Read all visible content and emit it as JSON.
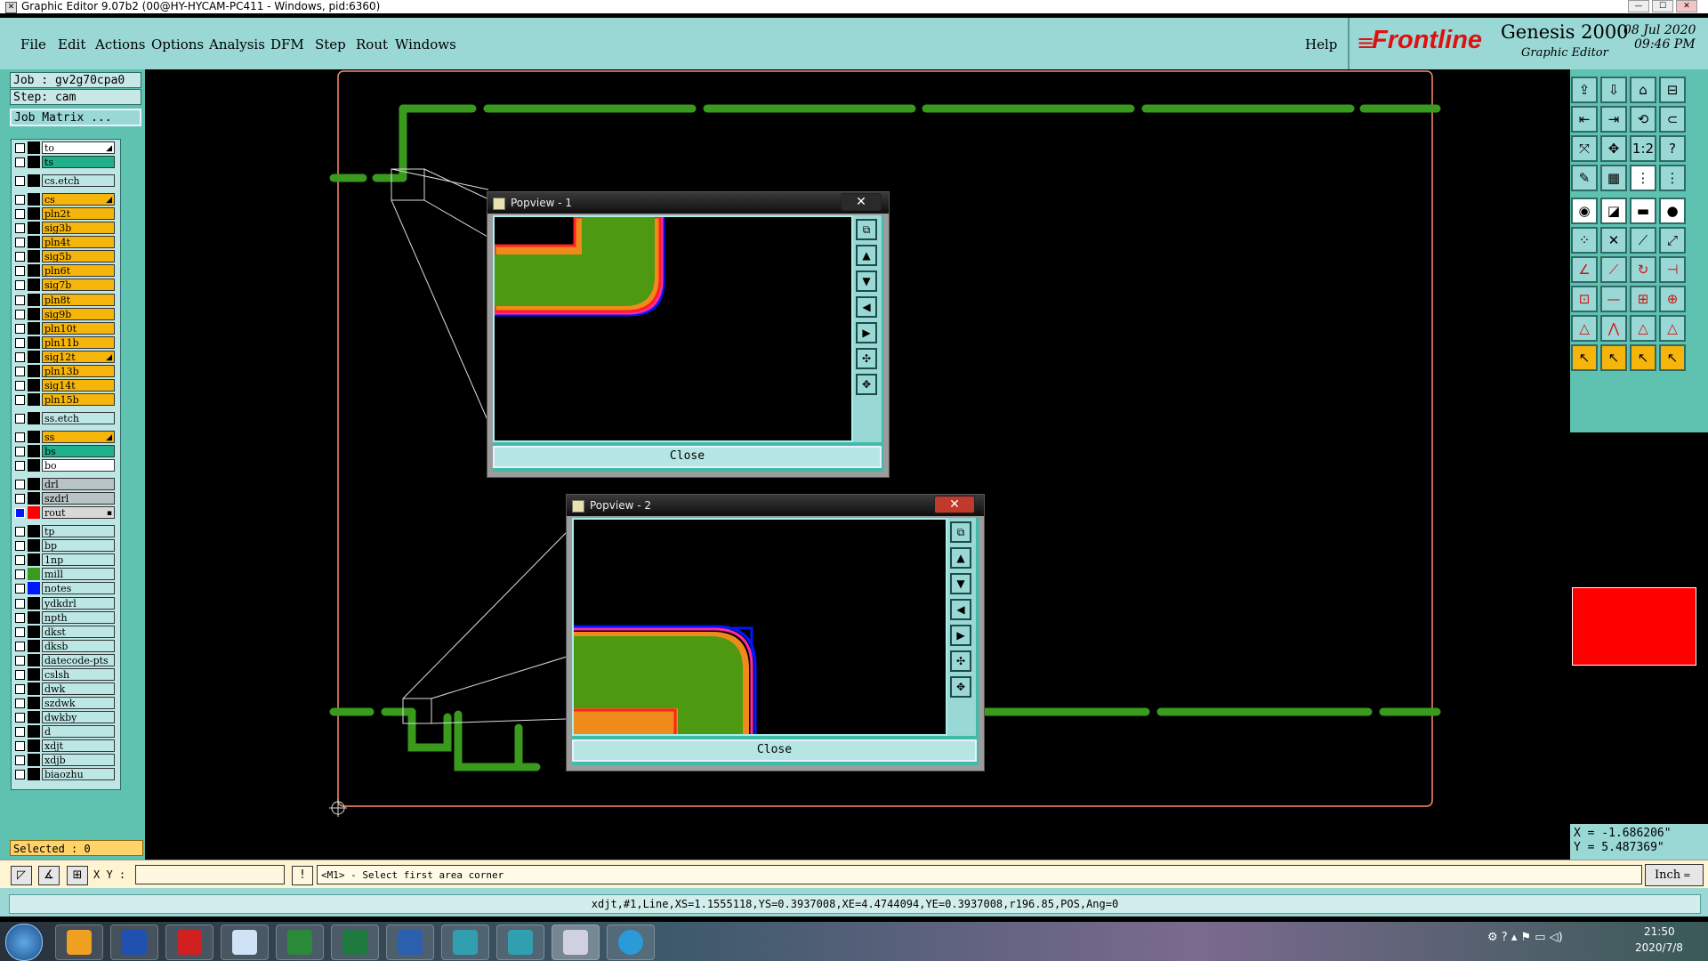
{
  "window": {
    "title": "Graphic Editor 9.07b2 (00@HY-HYCAM-PC411 - Windows, pid:6360)"
  },
  "menubar": {
    "items": [
      "File",
      "Edit",
      "Actions",
      "Options",
      "Analysis",
      "DFM",
      "Step",
      "Rout",
      "Windows"
    ],
    "help": "Help"
  },
  "logo": {
    "brand": "Frontline",
    "product": "Genesis 2000",
    "subtitle": "Graphic Editor",
    "date": "08 Jul 2020",
    "time": "09:46 PM"
  },
  "job": {
    "job_label": "Job : gv2g70cpa0",
    "step_label": "Step: cam",
    "matrix_button": "Job Matrix ..."
  },
  "layers": [
    {
      "name": "to",
      "color": "#ffffff",
      "group": 0,
      "mark": "◢"
    },
    {
      "name": "ts",
      "color": "#1fb08c",
      "group": 0
    },
    {
      "name": "cs.etch",
      "color": "#bde7e4",
      "group": 1
    },
    {
      "name": "cs",
      "color": "#f5b50a",
      "group": 2,
      "mark": "◢"
    },
    {
      "name": "pln2t",
      "color": "#f5b50a",
      "group": 2
    },
    {
      "name": "sig3b",
      "color": "#f5b50a",
      "group": 2
    },
    {
      "name": "pln4t",
      "color": "#f5b50a",
      "group": 2
    },
    {
      "name": "sig5b",
      "color": "#f5b50a",
      "group": 2
    },
    {
      "name": "pln6t",
      "color": "#f5b50a",
      "group": 2
    },
    {
      "name": "sig7b",
      "color": "#f5b50a",
      "group": 2
    },
    {
      "name": "pln8t",
      "color": "#f5b50a",
      "group": 2
    },
    {
      "name": "sig9b",
      "color": "#f5b50a",
      "group": 2
    },
    {
      "name": "pln10t",
      "color": "#f5b50a",
      "group": 2
    },
    {
      "name": "pln11b",
      "color": "#f5b50a",
      "group": 2
    },
    {
      "name": "sig12t",
      "color": "#f5b50a",
      "group": 2,
      "mark": "◢"
    },
    {
      "name": "pln13b",
      "color": "#f5b50a",
      "group": 2
    },
    {
      "name": "sig14t",
      "color": "#f5b50a",
      "group": 2
    },
    {
      "name": "pln15b",
      "color": "#f5b50a",
      "group": 2
    },
    {
      "name": "ss.etch",
      "color": "#bde7e4",
      "group": 3
    },
    {
      "name": "ss",
      "color": "#f5b50a",
      "group": 4,
      "mark": "◢"
    },
    {
      "name": "bs",
      "color": "#1fb08c",
      "group": 4
    },
    {
      "name": "bo",
      "color": "#ffffff",
      "group": 4
    },
    {
      "name": "drl",
      "color": "#b9c3c6",
      "group": 5
    },
    {
      "name": "szdrl",
      "color": "#b9c3c6",
      "group": 5
    },
    {
      "name": "rout",
      "color": "#d8d8d8",
      "group": 5,
      "swatch": "#ff0000",
      "mark": "▪",
      "active": true
    },
    {
      "name": "tp",
      "color": "#bde7e4",
      "group": 6
    },
    {
      "name": "bp",
      "color": "#bde7e4",
      "group": 6
    },
    {
      "name": "1np",
      "color": "#bde7e4",
      "group": 6
    },
    {
      "name": "mill",
      "color": "#bde7e4",
      "group": 6,
      "swatch": "#3a9a1e"
    },
    {
      "name": "notes",
      "color": "#bde7e4",
      "group": 6,
      "swatch": "#0018ff"
    },
    {
      "name": "ydkdrl",
      "color": "#bde7e4",
      "group": 6
    },
    {
      "name": "npth",
      "color": "#bde7e4",
      "group": 6
    },
    {
      "name": "dkst",
      "color": "#bde7e4",
      "group": 6
    },
    {
      "name": "dksb",
      "color": "#bde7e4",
      "group": 6
    },
    {
      "name": "datecode-pts",
      "color": "#bde7e4",
      "group": 6
    },
    {
      "name": "cslsh",
      "color": "#bde7e4",
      "group": 6
    },
    {
      "name": "dwk",
      "color": "#bde7e4",
      "group": 6
    },
    {
      "name": "szdwk",
      "color": "#bde7e4",
      "group": 6
    },
    {
      "name": "dwkby",
      "color": "#bde7e4",
      "group": 6
    },
    {
      "name": "d",
      "color": "#bde7e4",
      "group": 6
    },
    {
      "name": "xdjt",
      "color": "#bde7e4",
      "group": 6
    },
    {
      "name": "xdjb",
      "color": "#bde7e4",
      "group": 6
    },
    {
      "name": "biaozhu",
      "color": "#bde7e4",
      "group": 6
    }
  ],
  "selected": "Selected : 0",
  "popview1": {
    "title": "Popview - 1",
    "close_label": "Close"
  },
  "popview2": {
    "title": "Popview - 2",
    "close_label": "Close"
  },
  "coordinates": {
    "x": "X = -1.686206\"",
    "y": "Y = 5.487369\""
  },
  "command": {
    "xy_label": "X Y :",
    "xy_value": "",
    "prompt": "<M1> - Select first area corner",
    "units": "Inch"
  },
  "statusbar": {
    "text": "xdjt,#1,Line,XS=1.1555118,YS=0.3937008,XE=4.4744094,YE=0.3937008,r196.85,POS,Ang=0"
  },
  "taskbar": {
    "time": "21:50",
    "date": "2020/7/8"
  },
  "colors": {
    "panel": "#5fc2b0",
    "menubar": "#9ad8d6",
    "trace": "#3a9a1e",
    "rout": "#ff0000",
    "board_outline": "#ff8a6a"
  }
}
